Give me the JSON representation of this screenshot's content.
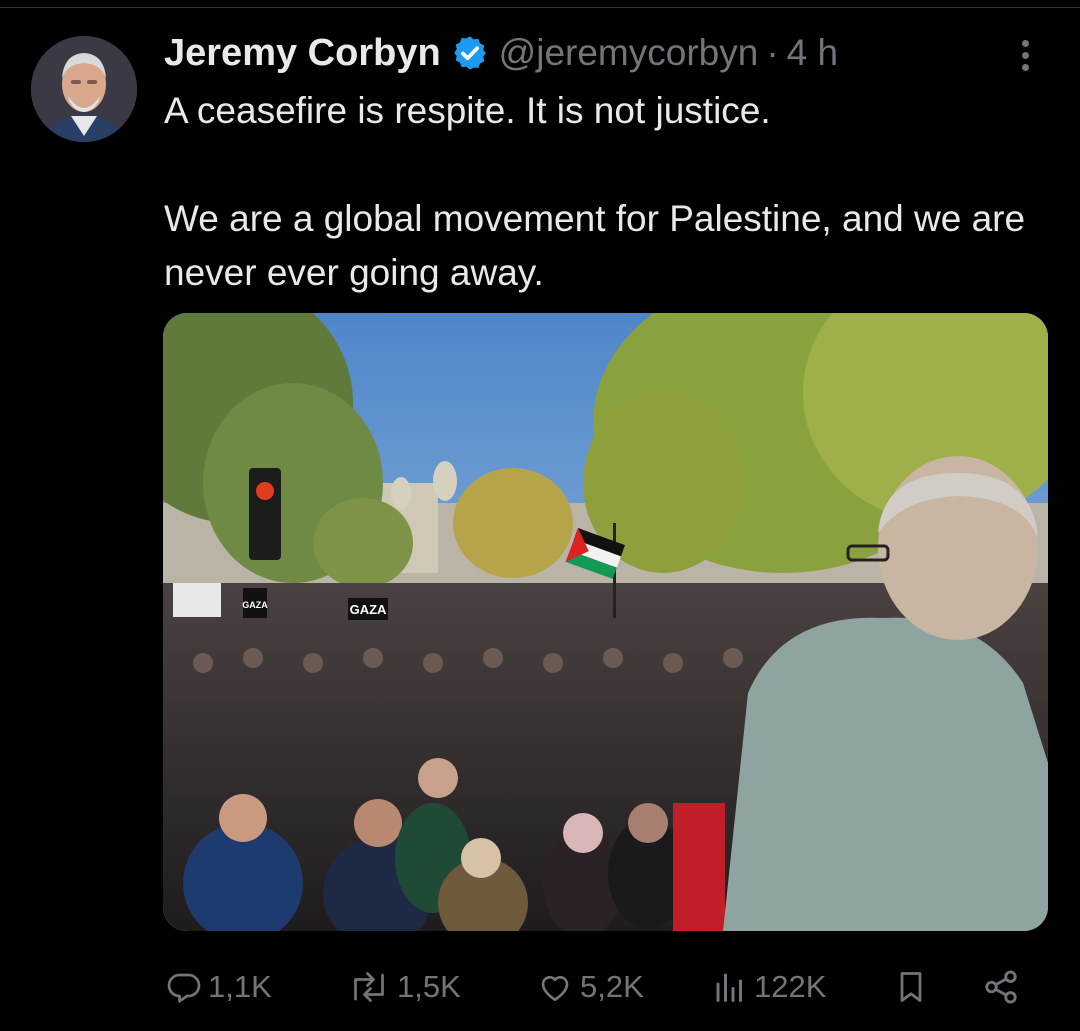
{
  "tweet": {
    "author_name": "Jeremy Corbyn",
    "handle": "@jeremycorbyn",
    "separator": "·",
    "time": "4 h",
    "text_line1": "A ceasefire is respite. It is not justice.",
    "text_line2": "We are a global movement for Palestine, and we are never ever going away."
  },
  "media": {
    "signs": [
      "GAZA",
      "GAZA"
    ]
  },
  "actions": {
    "replies": "1,1K",
    "reposts": "1,5K",
    "likes": "5,2K",
    "views": "122K"
  },
  "colors": {
    "background": "#000000",
    "text": "#e7e9ea",
    "muted": "#71767b",
    "verified": "#1d9bf0"
  },
  "icons": [
    "verified-badge-icon",
    "more-icon",
    "reply-icon",
    "repost-icon",
    "like-icon",
    "views-icon",
    "bookmark-icon",
    "share-icon"
  ]
}
